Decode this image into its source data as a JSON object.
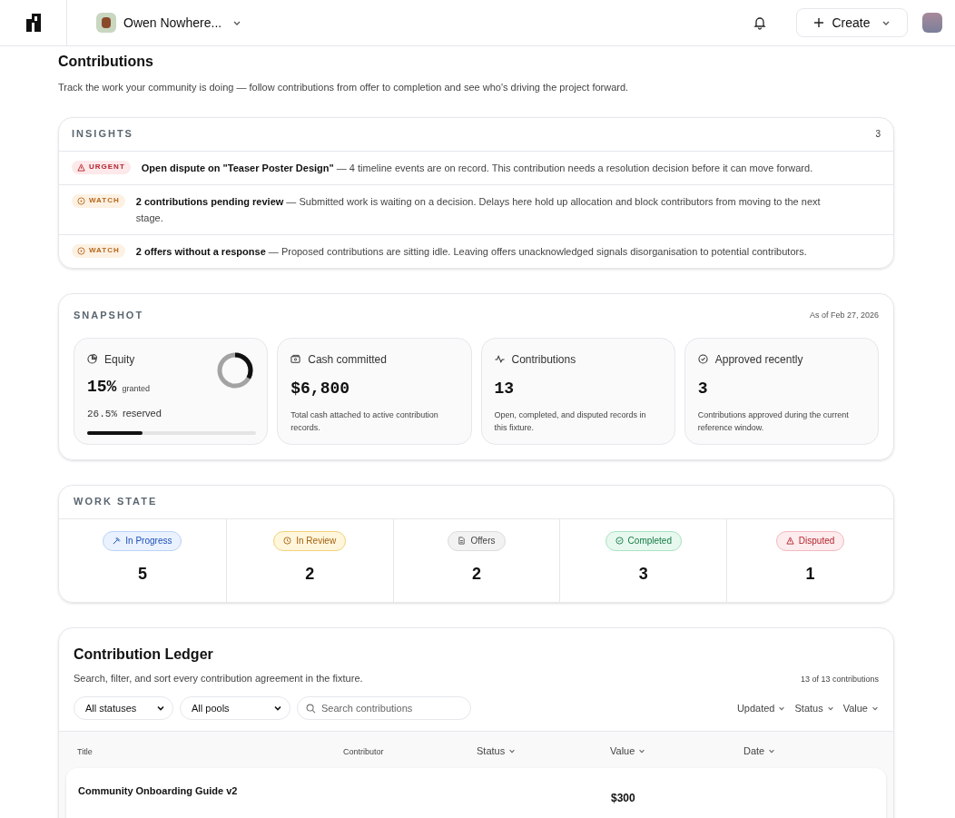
{
  "header": {
    "workspace": "Owen Nowhere...",
    "create_label": "Create"
  },
  "page": {
    "title": "Contributions",
    "subtitle": "Track the work your community is doing — follow contributions from offer to completion and see who's driving the project forward."
  },
  "insights": {
    "title": "INSIGHTS",
    "count": "3",
    "items": [
      {
        "kind": "urgent",
        "badge": "URGENT",
        "text": "**Open dispute on \"Teaser Poster Design\"** — 4 timeline events are on record. This contribution needs a resolution decision before it can move forward."
      },
      {
        "kind": "watch",
        "badge": "WATCH",
        "text": "**2 contributions pending review** — Submitted work is waiting on a decision. Delays here hold up allocation and block contributors from moving to the next stage."
      },
      {
        "kind": "watch",
        "badge": "WATCH",
        "text": "**2 offers without a response** — Proposed contributions are sitting idle. Leaving offers unacknowledged signals disorganisation to potential contributors."
      }
    ]
  },
  "snapshot": {
    "title": "SNAPSHOT",
    "as_of": "As of Feb 27, 2026",
    "cards": [
      {
        "kind": "equity",
        "label": "Equity",
        "value": "15%",
        "value_note": "granted",
        "secondary": "26.5%",
        "secondary_note": "reserved",
        "level": 0.33
      },
      {
        "kind": "cash",
        "label": "Cash committed",
        "value": "$6,800",
        "description": "Total cash attached to active contribution records."
      },
      {
        "kind": "count",
        "label": "Contributions",
        "value": "13",
        "description": "Open, completed, and disputed records in this fixture."
      },
      {
        "kind": "approved",
        "label": "Approved recently",
        "value": "3",
        "description": "Contributions approved during the current reference window."
      }
    ]
  },
  "work_state": {
    "title": "WORK STATE",
    "items": [
      {
        "kind": "progress",
        "label": "In Progress",
        "count": "5"
      },
      {
        "kind": "review",
        "label": "In Review",
        "count": "2"
      },
      {
        "kind": "offers",
        "label": "Offers",
        "count": "2"
      },
      {
        "kind": "completed",
        "label": "Completed",
        "count": "3"
      },
      {
        "kind": "disputed",
        "label": "Disputed",
        "count": "1"
      }
    ]
  },
  "ledger": {
    "title": "Contribution Ledger",
    "subtitle": "Search, filter, and sort every contribution agreement in the fixture.",
    "count": "13 of 13 contributions",
    "filters": [
      "All statuses",
      "All pools"
    ],
    "search": {
      "placeholder": "Search contributions"
    },
    "sorts": [
      "Updated",
      "Status",
      "Value"
    ],
    "columns": [
      {
        "label": "Title",
        "sortable": false
      },
      {
        "label": "Contributor",
        "sortable": false
      },
      {
        "label": "Status",
        "sortable": true
      },
      {
        "label": "Value",
        "sortable": true
      },
      {
        "label": "Date",
        "sortable": true
      }
    ],
    "rows": [
      {
        "title": "Community Onboarding Guide v2",
        "value": "$300"
      }
    ]
  }
}
